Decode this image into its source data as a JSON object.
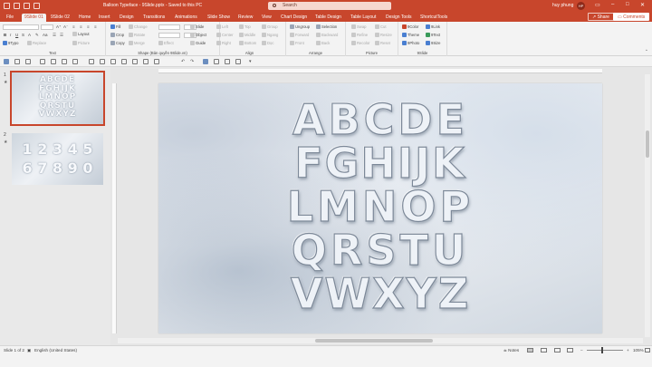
{
  "titlebar": {
    "title": "Balloon Typeface - 9Slide.pptx  -  Saved to this PC",
    "search_placeholder": "Search",
    "user": "huy phung",
    "avatar_initials": "HP"
  },
  "tabs": [
    {
      "label": "File"
    },
    {
      "label": "9Slide 01",
      "active": true
    },
    {
      "label": "9Slide 02"
    },
    {
      "label": "Home"
    },
    {
      "label": "Insert"
    },
    {
      "label": "Design"
    },
    {
      "label": "Transitions"
    },
    {
      "label": "Animations"
    },
    {
      "label": "Slide Show"
    },
    {
      "label": "Review"
    },
    {
      "label": "View"
    },
    {
      "label": "Chart Design"
    },
    {
      "label": "Table Design"
    },
    {
      "label": "Table Layout"
    },
    {
      "label": "Design Tools"
    },
    {
      "label": "ShortcutTools"
    }
  ],
  "share_label": "Share",
  "comments_label": "Comments",
  "ribbon": {
    "text_group": {
      "label": "Text",
      "layout": "Layout",
      "typo": "9Typo",
      "replace": "Replace",
      "picture": "Picture"
    },
    "shape_group": {
      "label": "Shape (Bản quyền 9Slide.vn)",
      "fill": "Fill",
      "crop": "Crop",
      "copy": "Copy",
      "change": "Change",
      "rotate": "Rotate",
      "merge": "Merge",
      "effect": "Effect"
    },
    "slide_col": {
      "slide": "Slide",
      "object": "Object",
      "guide": "Guide"
    },
    "align_group": {
      "label": "Align",
      "items": [
        "Left",
        "Top",
        "Group",
        "Center",
        "Middle",
        "Ngang",
        "Right",
        "Bottom",
        "Dọc"
      ]
    },
    "arrange_group": {
      "label": "Arrange",
      "ungroup": "Ungroup",
      "selection": "Selection",
      "forward": "Forward",
      "backward": "Backward",
      "front": "Front",
      "back": "Back"
    },
    "picture_group": {
      "label": "Picture",
      "items": [
        "Swap",
        "Cut",
        "Refine",
        "Resize",
        "Recolor",
        "Reset"
      ]
    },
    "nineslide_group": {
      "label": "9Slide",
      "items": [
        "9Color",
        "9Link",
        "Theme",
        "9Text",
        "9Photo",
        "9Size"
      ]
    }
  },
  "slides": [
    {
      "number": "1",
      "letters": "ABCDE\nFGHIJK\nLMNOP\nQRSTU\nVWXYZ"
    },
    {
      "number": "2",
      "letters": "1 2 3 4 5\n6 7 8 9 0"
    }
  ],
  "slide_main": {
    "rows": [
      "ABCDE",
      "FGHIJK",
      "LMNOP",
      "QRSTU",
      "VWXYZ"
    ]
  },
  "status": {
    "slide_of": "Slide 1 of 2",
    "language": "English (United States)",
    "notes": "Notes",
    "zoom": "105%"
  }
}
